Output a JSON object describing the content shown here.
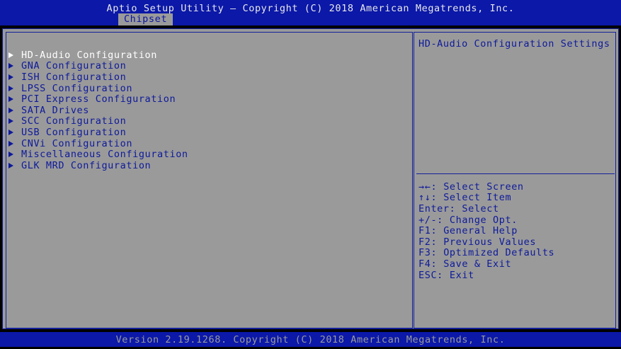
{
  "header": {
    "title": "Aptio Setup Utility – Copyright (C) 2018 American Megatrends, Inc.",
    "active_tab": "Chipset"
  },
  "menu": {
    "items": [
      {
        "label": "HD-Audio Configuration",
        "selected": true
      },
      {
        "label": "GNA Configuration",
        "selected": false
      },
      {
        "label": "ISH Configuration",
        "selected": false
      },
      {
        "label": "LPSS Configuration",
        "selected": false
      },
      {
        "label": "PCI Express Configuration",
        "selected": false
      },
      {
        "label": "SATA Drives",
        "selected": false
      },
      {
        "label": "SCC Configuration",
        "selected": false
      },
      {
        "label": "USB Configuration",
        "selected": false
      },
      {
        "label": "CNVi Configuration",
        "selected": false
      },
      {
        "label": "Miscellaneous Configuration",
        "selected": false
      },
      {
        "label": "GLK MRD Configuration",
        "selected": false
      }
    ]
  },
  "help": {
    "description": "HD-Audio Configuration Settings",
    "keys": [
      {
        "key": "→←:",
        "action": "Select Screen"
      },
      {
        "key": "↑↓:",
        "action": "Select Item"
      },
      {
        "key": "Enter:",
        "action": "Select"
      },
      {
        "key": "+/-:",
        "action": "Change Opt."
      },
      {
        "key": "F1:",
        "action": "General Help"
      },
      {
        "key": "F2:",
        "action": "Previous Values"
      },
      {
        "key": "F3:",
        "action": "Optimized Defaults"
      },
      {
        "key": "F4:",
        "action": "Save & Exit"
      },
      {
        "key": "ESC:",
        "action": "Exit"
      }
    ]
  },
  "footer": {
    "version": "Version 2.19.1268. Copyright (C) 2018 American Megatrends, Inc."
  },
  "colors": {
    "header_blue": "#0b18a8",
    "panel_gray": "#9a9a9a",
    "text_blue": "#0e1a9a",
    "selected_text": "#ffffff"
  }
}
